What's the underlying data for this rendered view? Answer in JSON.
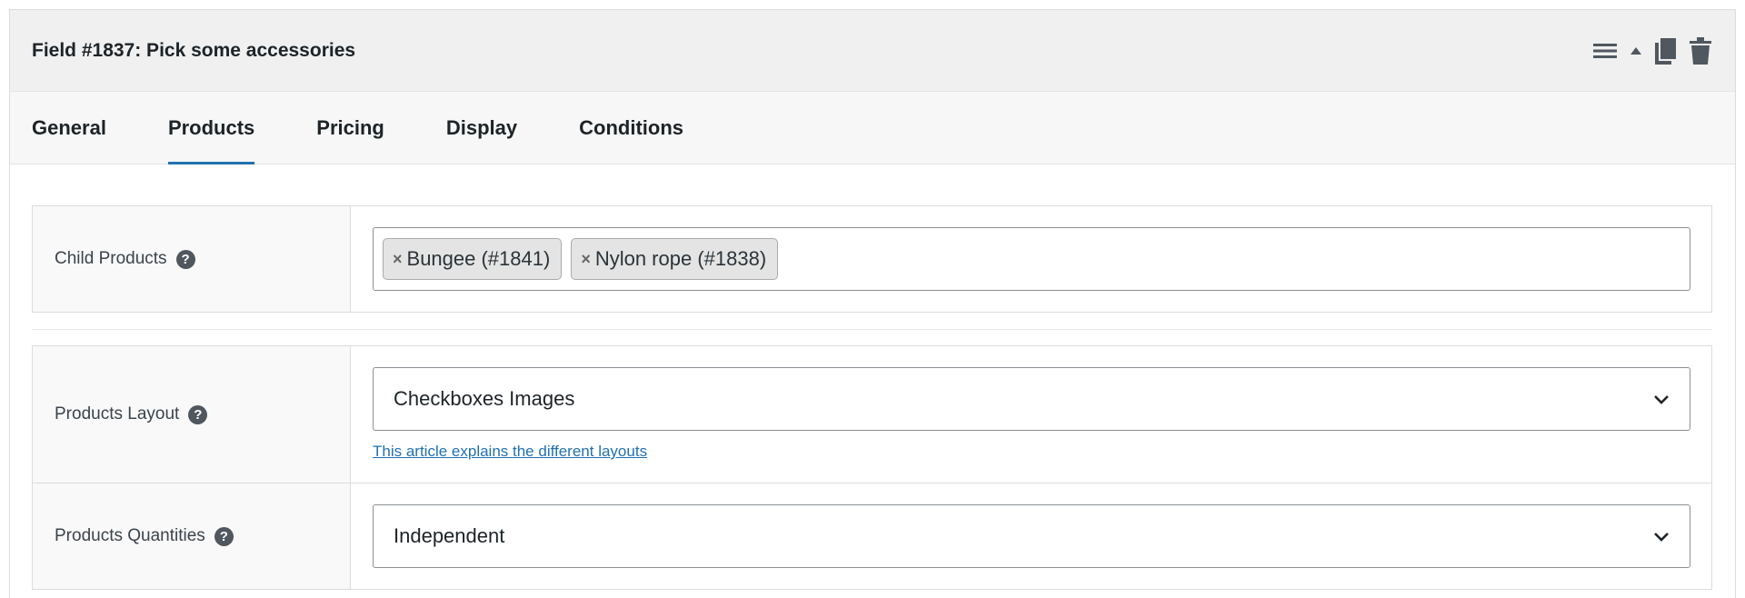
{
  "field": {
    "title": "Field #1837: Pick some accessories",
    "actions": [
      "menu-icon",
      "collapse-arrow-icon",
      "duplicate-icon",
      "trash-icon"
    ]
  },
  "tabs": [
    {
      "label": "General",
      "active": false
    },
    {
      "label": "Products",
      "active": true
    },
    {
      "label": "Pricing",
      "active": false
    },
    {
      "label": "Display",
      "active": false
    },
    {
      "label": "Conditions",
      "active": false
    }
  ],
  "child_products": {
    "label": "Child Products",
    "tags": [
      {
        "remove": "×",
        "label": "Bungee (#1841)"
      },
      {
        "remove": "×",
        "label": "Nylon rope (#1838)"
      }
    ]
  },
  "products_layout": {
    "label": "Products Layout",
    "value": "Checkboxes Images",
    "link": "This article explains the different layouts"
  },
  "products_quantities": {
    "label": "Products Quantities",
    "value": "Independent"
  },
  "help_glyph": "?",
  "colors": {
    "accent": "#2271b1",
    "header_bg": "#f0f0f1",
    "tabs_bg": "#f7f7f7",
    "icon": "#50575e"
  }
}
